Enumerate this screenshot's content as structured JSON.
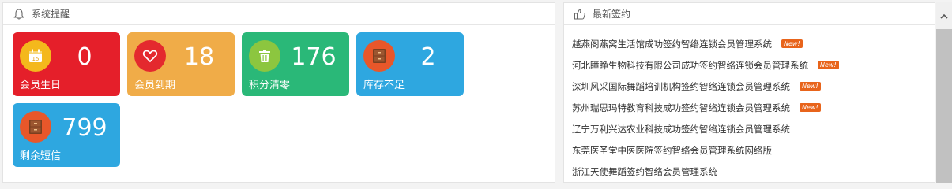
{
  "reminders": {
    "title": "系统提醒",
    "tiles": [
      {
        "label": "会员生日",
        "value": "0",
        "color": "#e51f2a",
        "icon": "calendar-icon"
      },
      {
        "label": "会员到期",
        "value": "18",
        "color": "#f0ac48",
        "icon": "heart-icon"
      },
      {
        "label": "积分清零",
        "value": "176",
        "color": "#2ab878",
        "icon": "trash-icon"
      },
      {
        "label": "库存不足",
        "value": "2",
        "color": "#2ea7e0",
        "icon": "cabinet-icon"
      },
      {
        "label": "剩余短信",
        "value": "799",
        "color": "#2ea7e0",
        "icon": "cabinet-icon"
      }
    ]
  },
  "signings": {
    "title": "最新签约",
    "badge_label": "New!",
    "items": [
      {
        "text": "越燕阁燕窝生活馆成功签约智络连锁会员管理系统",
        "is_new": true
      },
      {
        "text": "河北瞳睁生物科技有限公司成功签约智络连锁会员管理系统",
        "is_new": true
      },
      {
        "text": "深圳风采国际舞蹈培训机构签约智络连锁会员管理系统",
        "is_new": true
      },
      {
        "text": "苏州瑞思玛特教育科技成功签约智络连锁会员管理系统",
        "is_new": true
      },
      {
        "text": "辽宁万利兴达农业科技成功签约智络连锁会员管理系统",
        "is_new": false
      },
      {
        "text": "东莞医圣堂中医医院签约智络会员管理系统网络版",
        "is_new": false
      },
      {
        "text": "浙江天使舞蹈签约智络会员管理系统",
        "is_new": false
      }
    ]
  }
}
